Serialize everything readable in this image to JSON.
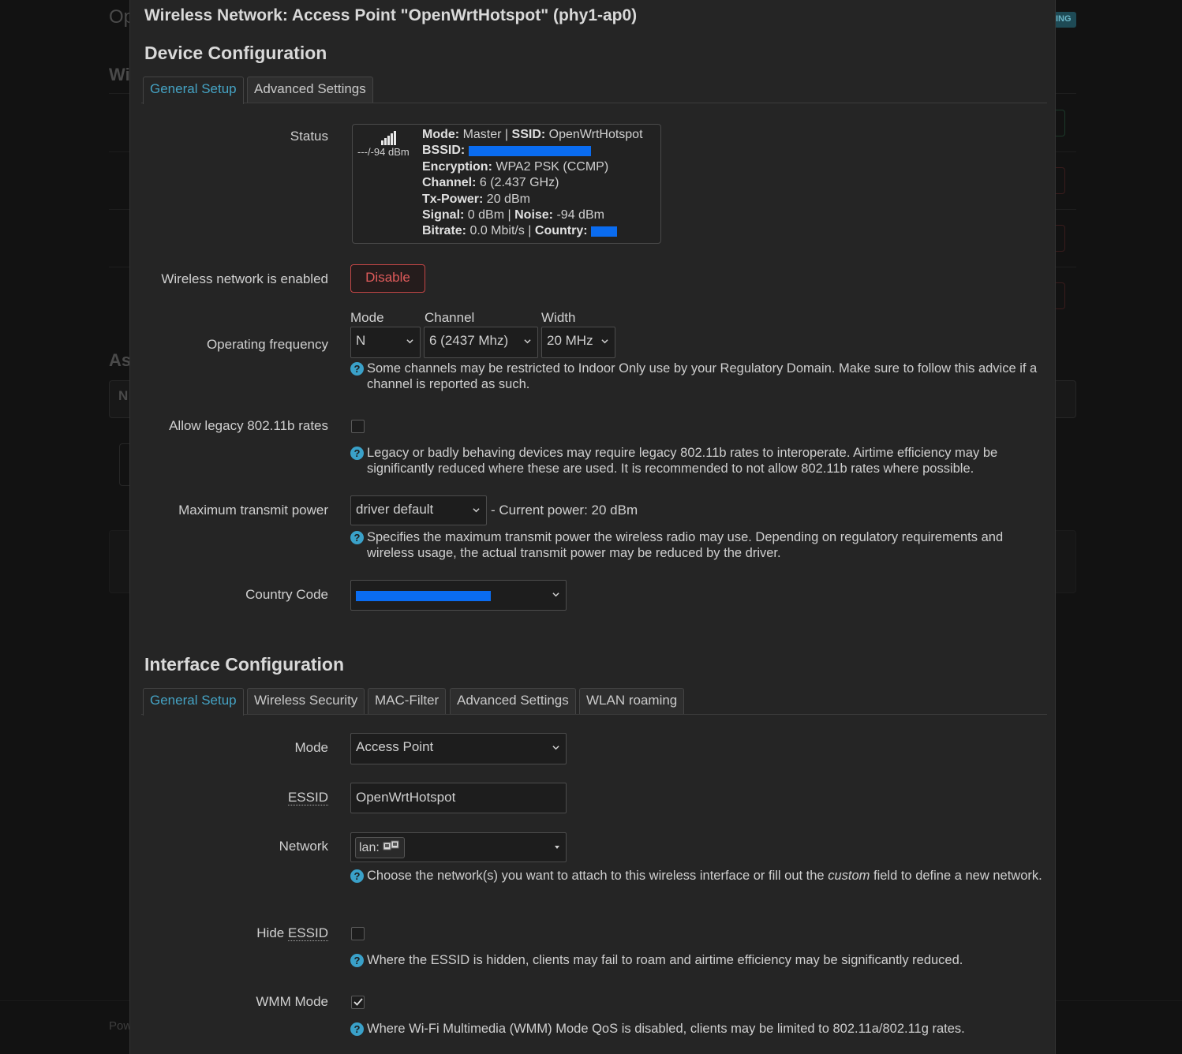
{
  "background": {
    "title_fragment": "Op",
    "section_fragment_1": "Wi",
    "section_fragment_2": "As",
    "table_fragment": "N",
    "badge_fragment": "ING",
    "footer_fragment": "Pow"
  },
  "modal": {
    "title": "Wireless Network: Access Point \"OpenWrtHotspot\" (phy1-ap0)"
  },
  "device_config": {
    "title": "Device Configuration",
    "tabs": [
      {
        "label": "General Setup",
        "active": true
      },
      {
        "label": "Advanced Settings",
        "active": false
      }
    ],
    "status": {
      "label": "Status",
      "signal_text": "---/-94 dBm",
      "mode_key": "Mode:",
      "mode_val": "Master",
      "ssid_key": "SSID:",
      "ssid_val": "OpenWrtHotspot",
      "bssid_key": "BSSID:",
      "encryption_key": "Encryption:",
      "encryption_val": "WPA2 PSK (CCMP)",
      "channel_key": "Channel:",
      "channel_val": "6 (2.437 GHz)",
      "txpower_key": "Tx-Power:",
      "txpower_val": "20 dBm",
      "signal_key": "Signal:",
      "signal_val": "0 dBm",
      "noise_key": "Noise:",
      "noise_val": "-94 dBm",
      "bitrate_key": "Bitrate:",
      "bitrate_val": "0.0 Mbit/s",
      "country_key": "Country:",
      "separator": "|"
    },
    "enabled": {
      "label": "Wireless network is enabled",
      "button": "Disable"
    },
    "frequency": {
      "label": "Operating frequency",
      "mode_label": "Mode",
      "mode_value": "N",
      "channel_label": "Channel",
      "channel_value": "6 (2437 Mhz)",
      "width_label": "Width",
      "width_value": "20 MHz",
      "hint": "Some channels may be restricted to Indoor Only use by your Regulatory Domain. Make sure to follow this advice if a channel is reported as such."
    },
    "legacy": {
      "label": "Allow legacy 802.11b rates",
      "checked": false,
      "hint": "Legacy or badly behaving devices may require legacy 802.11b rates to interoperate. Airtime efficiency may be significantly reduced where these are used. It is recommended to not allow 802.11b rates where possible."
    },
    "txpower": {
      "label": "Maximum transmit power",
      "value": "driver default",
      "current": "- Current power: 20 dBm",
      "hint": "Specifies the maximum transmit power the wireless radio may use. Depending on regulatory requirements and wireless usage, the actual transmit power may be reduced by the driver."
    },
    "country": {
      "label": "Country Code"
    }
  },
  "interface_config": {
    "title": "Interface Configuration",
    "tabs": [
      {
        "label": "General Setup",
        "active": true
      },
      {
        "label": "Wireless Security",
        "active": false
      },
      {
        "label": "MAC-Filter",
        "active": false
      },
      {
        "label": "Advanced Settings",
        "active": false
      },
      {
        "label": "WLAN roaming",
        "active": false
      }
    ],
    "mode": {
      "label": "Mode",
      "value": "Access Point"
    },
    "essid": {
      "label": "ESSID",
      "value": "OpenWrtHotspot"
    },
    "network": {
      "label": "Network",
      "tag": "lan:",
      "hint_before": "Choose the network(s) you want to attach to this wireless interface or fill out the",
      "hint_em": "custom",
      "hint_after": "field to define a new network."
    },
    "hide_essid": {
      "label_prefix": "Hide",
      "label_abbr": "ESSID",
      "checked": false,
      "hint": "Where the ESSID is hidden, clients may fail to roam and airtime efficiency may be significantly reduced."
    },
    "wmm": {
      "label": "WMM Mode",
      "checked": true,
      "hint": "Where Wi-Fi Multimedia (WMM) Mode QoS is disabled, clients may be limited to 802.11a/802.11g rates."
    }
  },
  "colors": {
    "accent": "#45a3c4",
    "danger": "#e05b5b",
    "redaction": "#0a6cf0"
  },
  "icons": {
    "signal": "signal-bars-icon",
    "help": "help-circle-icon",
    "network": "ethernet-ports-icon",
    "chevron": "chevron-down-icon"
  }
}
